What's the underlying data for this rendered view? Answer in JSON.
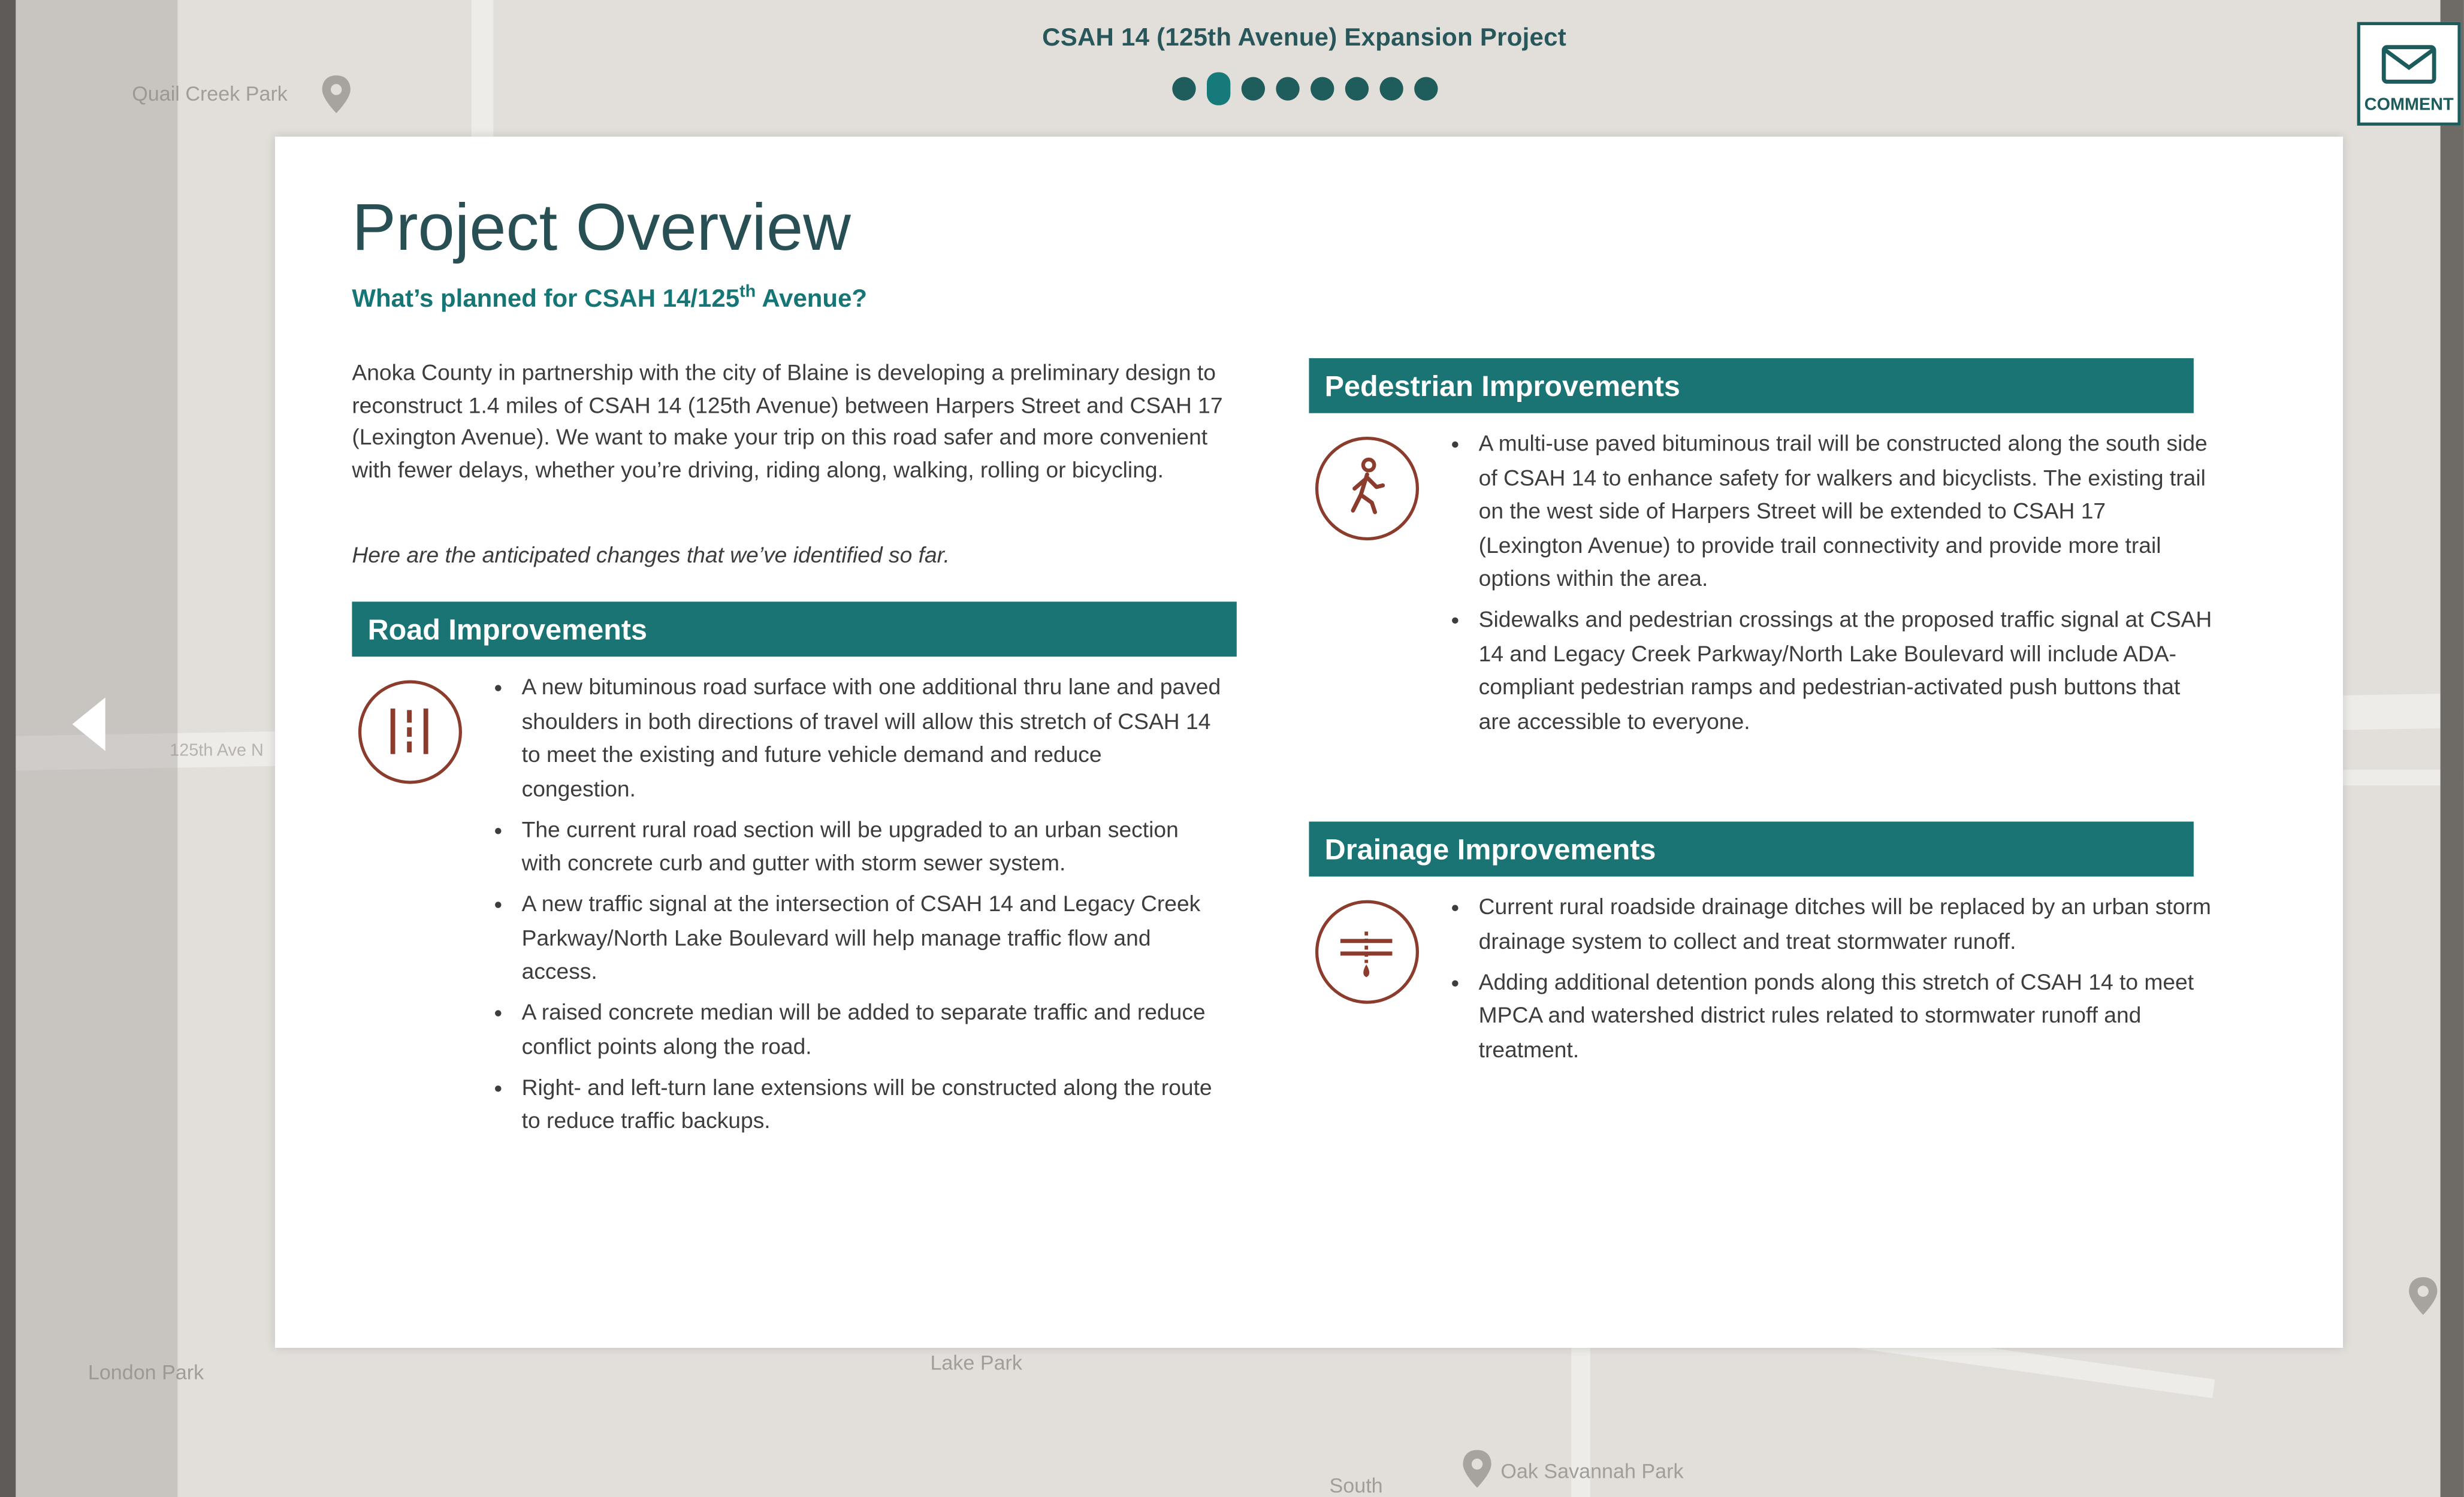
{
  "header": {
    "project_title": "CSAH 14 (125th Avenue) Expansion Project",
    "slides_total": 8,
    "current_slide": 2,
    "comment_label": "COMMENT"
  },
  "map": {
    "labels": [
      "Quail Creek Park",
      "London Park",
      "Lake Park",
      "Oak Savannah Park",
      "125th Ave N",
      "South"
    ]
  },
  "overview": {
    "title": "Project Overview",
    "subtitle_prefix": "What’s planned for CSAH 14/125",
    "subtitle_sup": "th",
    "subtitle_suffix": " Avenue?",
    "intro": "Anoka County in partnership with the city of Blaine is developing a preliminary design to reconstruct 1.4 miles of CSAH 14 (125th Avenue) between Harpers Street and CSAH 17 (Lexington Avenue). We want to make your trip on this road safer and more convenient with fewer delays, whether you’re driving, riding along, walking, rolling or bicycling.",
    "intro_note": "Here are the anticipated changes that we’ve identified so far."
  },
  "road": {
    "heading": "Road Improvements",
    "icon": "road-lanes-icon",
    "items": [
      "A new bituminous road surface with one additional thru lane and paved shoulders in both directions of travel will allow this stretch of CSAH 14 to meet the existing and future vehicle demand and reduce congestion.",
      "The current rural road section will be upgraded to an urban section with concrete curb and gutter with storm sewer system.",
      "A new traffic signal at the intersection of CSAH 14 and Legacy Creek Parkway/North Lake Boulevard will help manage traffic flow and access.",
      "A raised concrete median will be added to separate traffic and reduce conflict points along the road.",
      "Right- and left-turn lane extensions will be constructed along the route to reduce traffic backups."
    ]
  },
  "pedestrian": {
    "heading": "Pedestrian Improvements",
    "icon": "pedestrian-icon",
    "items": [
      "A multi-use paved bituminous trail will be constructed along the south side of CSAH 14 to enhance safety for walkers and bicyclists. The existing trail on the west side of Harpers Street will be extended to CSAH 17 (Lexington Avenue) to provide trail connectivity and provide more trail options within the area.",
      "Sidewalks and pedestrian crossings at the proposed traffic signal at CSAH 14 and Legacy Creek Parkway/North Lake Boulevard will include ADA-compliant pedestrian ramps and pedestrian-activated push buttons that are accessible to everyone."
    ]
  },
  "drainage": {
    "heading": "Drainage Improvements",
    "icon": "drainage-icon",
    "items": [
      "Current rural roadside drainage ditches will be replaced by an urban storm drainage system to collect and treat stormwater runoff.",
      "Adding additional detention ponds along this stretch of CSAH 14 to meet MPCA and watershed district rules related to stormwater runoff and treatment."
    ]
  },
  "colors": {
    "teal": "#1b7474",
    "title_teal": "#274f54",
    "icon_brown": "#8b3c2c"
  }
}
